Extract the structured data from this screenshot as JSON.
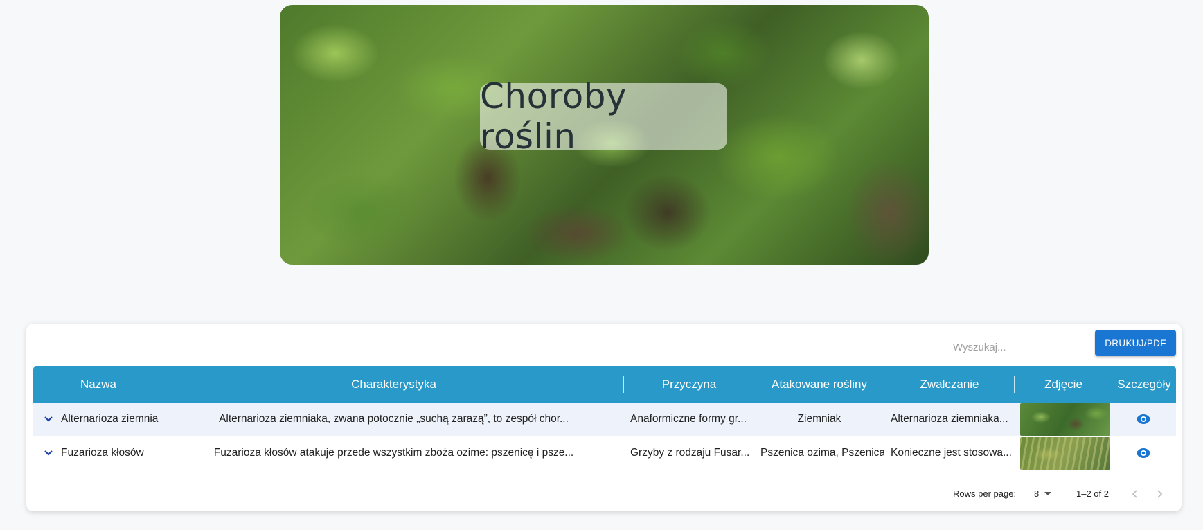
{
  "hero": {
    "title": "Choroby roślin"
  },
  "toolbar": {
    "search_placeholder": "Wyszukaj...",
    "print_label": "DRUKUJ/PDF"
  },
  "table": {
    "columns": [
      "Nazwa",
      "Charakterystyka",
      "Przyczyna",
      "Atakowane rośliny",
      "Zwalczanie",
      "Zdjęcie",
      "Szczegóły"
    ],
    "rows": [
      {
        "name": "Alternarioza ziemnia",
        "characteristic": "Alternarioza ziemniaka, zwana potocznie „suchą zarazą”, to zespół chor...",
        "cause": "Anaformiczne formy gr...",
        "plants": "Ziemniak",
        "control": "Alternarioza ziemniaka..."
      },
      {
        "name": "Fuzarioza kłosów",
        "characteristic": "Fuzarioza kłosów atakuje przede wszystkim zboża ozime: pszenicę i psze...",
        "cause": "Grzyby z rodzaju Fusar...",
        "plants": "Pszenica ozima, Pszenica j",
        "control": "Konieczne jest stosowa..."
      }
    ]
  },
  "pagination": {
    "rows_per_page_label": "Rows per page:",
    "rows_per_page_value": "8",
    "range": "1–2 of 2"
  },
  "colors": {
    "header": "#2899c8",
    "accent": "#1976d2",
    "selected_row": "#eef3fb"
  }
}
